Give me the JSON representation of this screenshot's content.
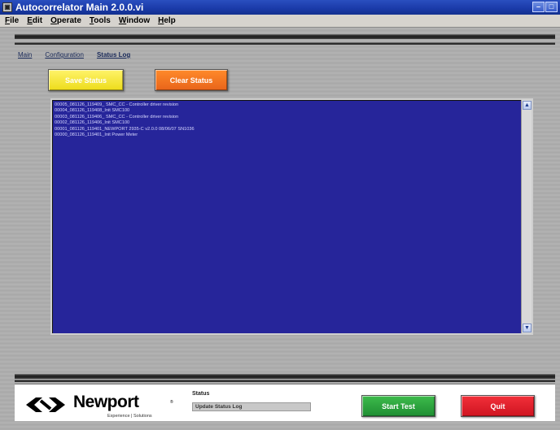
{
  "window": {
    "title": "Autocorrelator Main 2.0.0.vi",
    "controls": [
      "–",
      "□"
    ]
  },
  "menu": {
    "items": [
      "File",
      "Edit",
      "Operate",
      "Tools",
      "Window",
      "Help"
    ]
  },
  "nav": {
    "tabs": [
      "Main",
      "Configuration",
      "Status Log"
    ],
    "active": "Status Log"
  },
  "actions": {
    "save_label": "Save Status",
    "clear_label": "Clear Status"
  },
  "log": {
    "lines": [
      "00005_081126_119409_ SMC_CC - Controller driver revision",
      "00004_081126_119408_Init SMC100",
      "00003_081126_119406_ SMC_CC - Controller driver revision",
      "00002_081126_119406_Init SMC100",
      "00001_081126_119401_NEWPORT 2935-C v2.0.0 08/06/07 SN1036",
      "00000_081126_119401_Init Power Meter"
    ]
  },
  "footer": {
    "brand": "Newport",
    "tagline": "Experience | Solutions",
    "status_label": "Status",
    "status_value": "Update Status Log",
    "start_label": "Start Test",
    "quit_label": "Quit"
  },
  "colors": {
    "log_background": "#26259a",
    "save_button": "#eddc1a",
    "clear_button": "#e8641a",
    "start_button": "#1f8e33",
    "quit_button": "#cf1420",
    "titlebar": "#1a3aa8"
  }
}
